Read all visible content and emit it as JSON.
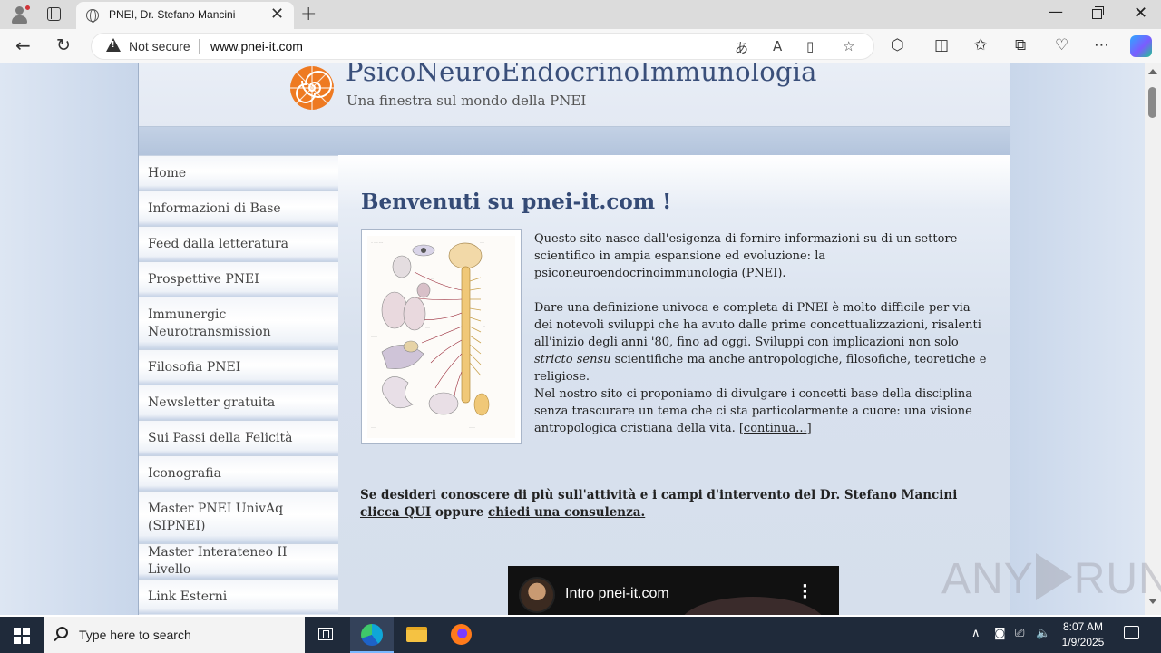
{
  "browser": {
    "tab_title": "PNEI, Dr. Stefano Mancini",
    "security_label": "Not secure",
    "url": "www.pnei-it.com"
  },
  "site": {
    "title": "PsicoNeuroEndocrinoImmunologia",
    "subtitle": "Una finestra sul mondo della PNEI",
    "menu": [
      {
        "label": "Home"
      },
      {
        "label": "Informazioni di Base"
      },
      {
        "label": "Feed dalla letteratura"
      },
      {
        "label": "Prospettive PNEI"
      },
      {
        "label": "Immunergic Neurotransmission"
      },
      {
        "label": "Filosofia PNEI"
      },
      {
        "label": "Newsletter gratuita"
      },
      {
        "label": "Sui Passi della Felicità"
      },
      {
        "label": "Iconografia"
      },
      {
        "label": "Master PNEI UnivAq (SIPNEI)"
      },
      {
        "label": "Master Interateneo II Livello"
      },
      {
        "label": "Link Esterni"
      }
    ],
    "welcome": "Benvenuti su pnei-it.com !",
    "para1": "Questo sito nasce dall'esigenza di fornire informazioni su di un settore scientifico in ampia espansione ed evoluzione: la psiconeuroendocrinoimmunologia (PNEI).",
    "para2_a": "Dare una definizione univoca e completa di PNEI è molto difficile per via dei notevoli sviluppi che ha avuto dalle prime concettualizzazioni, risalenti all'inizio degli anni '80, fino ad oggi. Sviluppi con implicazioni non solo ",
    "para2_em": "stricto sensu",
    "para2_b": " scientifiche ma anche antropologiche, filosofiche, teoretiche e religiose.",
    "para3": "Nel nostro sito ci proponiamo di divulgare i concetti base della disciplina senza trascurare un tema che ci sta particolarmente a cuore: una visione antropologica cristiana della vita. ",
    "continue_link": "[continua...]",
    "contact_pre": "Se desideri conoscere di più sull'attività e i campi d'intervento del Dr. Stefano Mancini ",
    "contact_link1": "clicca QUI",
    "contact_mid": " oppure ",
    "contact_link2": "chiedi una consulenza.",
    "video_title": "Intro pnei-it.com"
  },
  "watermark": "ANY RUN",
  "taskbar": {
    "search_placeholder": "Type here to search",
    "time": "8:07 AM",
    "date": "1/9/2025"
  },
  "colors": {
    "page_bg": "#c8d6ea",
    "title": "#3a4f7a",
    "heading": "#354b76",
    "taskbar": "#1f2a3a",
    "logo": "#ee7a22"
  }
}
